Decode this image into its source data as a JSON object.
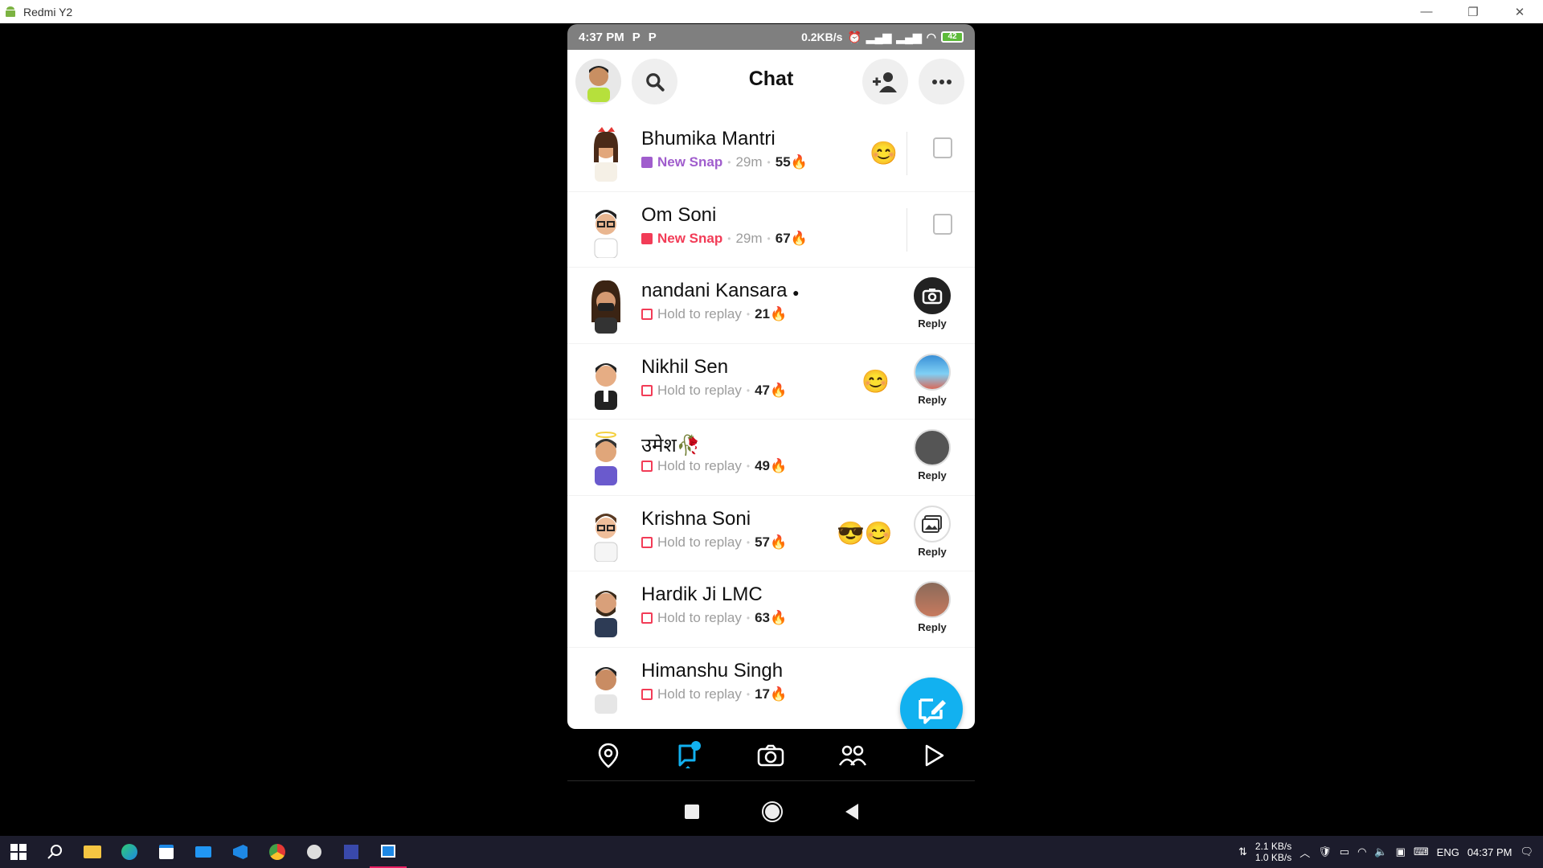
{
  "window": {
    "title": "Redmi Y2"
  },
  "status_bar": {
    "time": "4:37 PM",
    "left_icons": [
      "P",
      "P"
    ],
    "net_speed": "0.2KB/s",
    "battery": "42"
  },
  "header": {
    "title": "Chat"
  },
  "chats": [
    {
      "name": "Bhumika Mantri",
      "status": "New Snap",
      "status_color": "#a05dcd",
      "time": "29m",
      "streak": "55",
      "emoji": "😊",
      "action": "chat"
    },
    {
      "name": "Om Soni",
      "status": "New Snap",
      "status_color": "#f23c57",
      "time": "29m",
      "streak": "67",
      "action": "chat"
    },
    {
      "name": "nandani Kansara",
      "name_suffix": "●",
      "status": "Hold to replay",
      "streak": "21",
      "action_label": "Reply"
    },
    {
      "name": "Nikhil Sen",
      "status": "Hold to replay",
      "streak": "47",
      "emoji": "😊",
      "action_label": "Reply"
    },
    {
      "name": "उमेश🥀",
      "status": "Hold to replay",
      "streak": "49",
      "action_label": "Reply"
    },
    {
      "name": "Krishna Soni",
      "status": "Hold to replay",
      "streak": "57",
      "emoji": "😎😊",
      "action_label": "Reply"
    },
    {
      "name": "Hardik Ji LMC",
      "status": "Hold to replay",
      "streak": "63",
      "action_label": "Reply"
    },
    {
      "name": "Himanshu Singh",
      "status": "Hold to replay",
      "streak": "17"
    }
  ],
  "flame": "🔥",
  "taskbar": {
    "net_down": "2.1 KB/s",
    "net_up": "1.0 KB/s",
    "language": "ENG",
    "time": "04:37 PM"
  },
  "colors": {
    "accent": "#12b1f0",
    "new_snap_red": "#f23c57",
    "new_snap_purple": "#a05dcd"
  }
}
